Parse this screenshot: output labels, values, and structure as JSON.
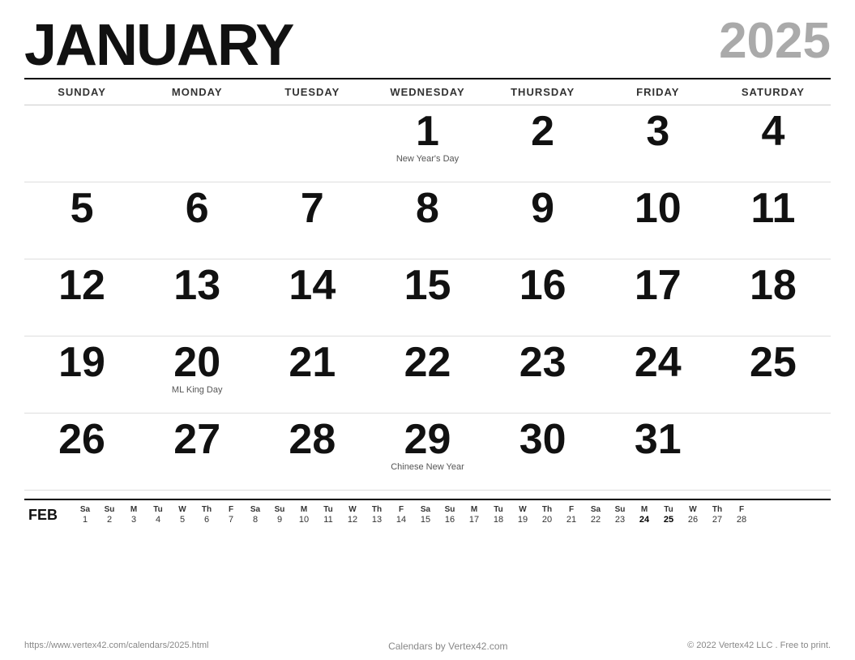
{
  "header": {
    "month": "JANUARY",
    "year": "2025"
  },
  "dayHeaders": [
    "SUNDAY",
    "MONDAY",
    "TUESDAY",
    "WEDNESDAY",
    "THURSDAY",
    "FRIDAY",
    "SATURDAY"
  ],
  "weeks": [
    [
      {
        "day": "",
        "event": ""
      },
      {
        "day": "",
        "event": ""
      },
      {
        "day": "",
        "event": ""
      },
      {
        "day": "1",
        "event": "New Year's Day"
      },
      {
        "day": "2",
        "event": ""
      },
      {
        "day": "3",
        "event": ""
      },
      {
        "day": "4",
        "event": ""
      }
    ],
    [
      {
        "day": "5",
        "event": ""
      },
      {
        "day": "6",
        "event": ""
      },
      {
        "day": "7",
        "event": ""
      },
      {
        "day": "8",
        "event": ""
      },
      {
        "day": "9",
        "event": ""
      },
      {
        "day": "10",
        "event": ""
      },
      {
        "day": "11",
        "event": ""
      }
    ],
    [
      {
        "day": "12",
        "event": ""
      },
      {
        "day": "13",
        "event": ""
      },
      {
        "day": "14",
        "event": ""
      },
      {
        "day": "15",
        "event": ""
      },
      {
        "day": "16",
        "event": ""
      },
      {
        "day": "17",
        "event": ""
      },
      {
        "day": "18",
        "event": ""
      }
    ],
    [
      {
        "day": "19",
        "event": ""
      },
      {
        "day": "20",
        "event": "ML King Day"
      },
      {
        "day": "21",
        "event": ""
      },
      {
        "day": "22",
        "event": ""
      },
      {
        "day": "23",
        "event": ""
      },
      {
        "day": "24",
        "event": ""
      },
      {
        "day": "25",
        "event": ""
      }
    ],
    [
      {
        "day": "26",
        "event": ""
      },
      {
        "day": "27",
        "event": ""
      },
      {
        "day": "28",
        "event": ""
      },
      {
        "day": "29",
        "event": "Chinese New Year"
      },
      {
        "day": "30",
        "event": ""
      },
      {
        "day": "31",
        "event": ""
      },
      {
        "day": "",
        "event": ""
      }
    ]
  ],
  "miniCalendar": {
    "label": "FEB",
    "weeks": [
      {
        "headers": [
          "Sa",
          "Su",
          "M",
          "Tu",
          "W",
          "Th",
          "F",
          "Sa",
          "Su",
          "M",
          "Tu",
          "W",
          "Th",
          "F",
          "Sa",
          "Su",
          "M",
          "Tu",
          "W",
          "Th",
          "F",
          "Sa",
          "Su",
          "M",
          "Tu",
          "W",
          "Th",
          "F"
        ],
        "days": [
          "1",
          "2",
          "3",
          "4",
          "5",
          "6",
          "7",
          "8",
          "9",
          "10",
          "11",
          "12",
          "13",
          "14",
          "15",
          "16",
          "17",
          "18",
          "19",
          "20",
          "21",
          "22",
          "23",
          "24",
          "25",
          "26",
          "27",
          "28"
        ]
      }
    ],
    "boldDays": [
      "24",
      "25"
    ]
  },
  "footer": {
    "left": "https://www.vertex42.com/calendars/2025.html",
    "center": "Calendars by Vertex42.com",
    "right": "© 2022 Vertex42 LLC . Free to print."
  }
}
